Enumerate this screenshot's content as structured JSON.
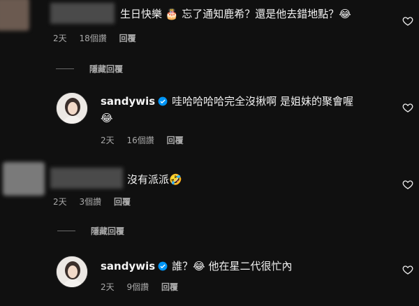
{
  "comments": [
    {
      "text": "生日快樂 🎂 忘了通知鹿希？還是他去錯地點？😂",
      "time": "2天",
      "likes": "18個讚",
      "reply_label": "回覆"
    },
    {
      "username": "sandywis",
      "text_line1": "哇哈哈哈哈完全沒揪啊 是姐妹的聚會喔",
      "text_line2": "😂",
      "time": "2天",
      "likes": "16個讚",
      "reply_label": "回覆"
    },
    {
      "text": "沒有派派🤣",
      "time": "2天",
      "likes": "3個讚",
      "reply_label": "回覆"
    },
    {
      "username": "sandywis",
      "text": "誰？😂 他在星二代很忙內",
      "time": "2天",
      "likes": "9個讚",
      "reply_label": "回覆"
    }
  ],
  "hidden_replies_label": "隱藏回覆",
  "icons": {
    "like": "heart-outline-icon",
    "verified": "verified-badge-icon"
  },
  "colors": {
    "background": "#101010",
    "verified": "#0095f6",
    "meta_text": "#a8a8a8"
  }
}
